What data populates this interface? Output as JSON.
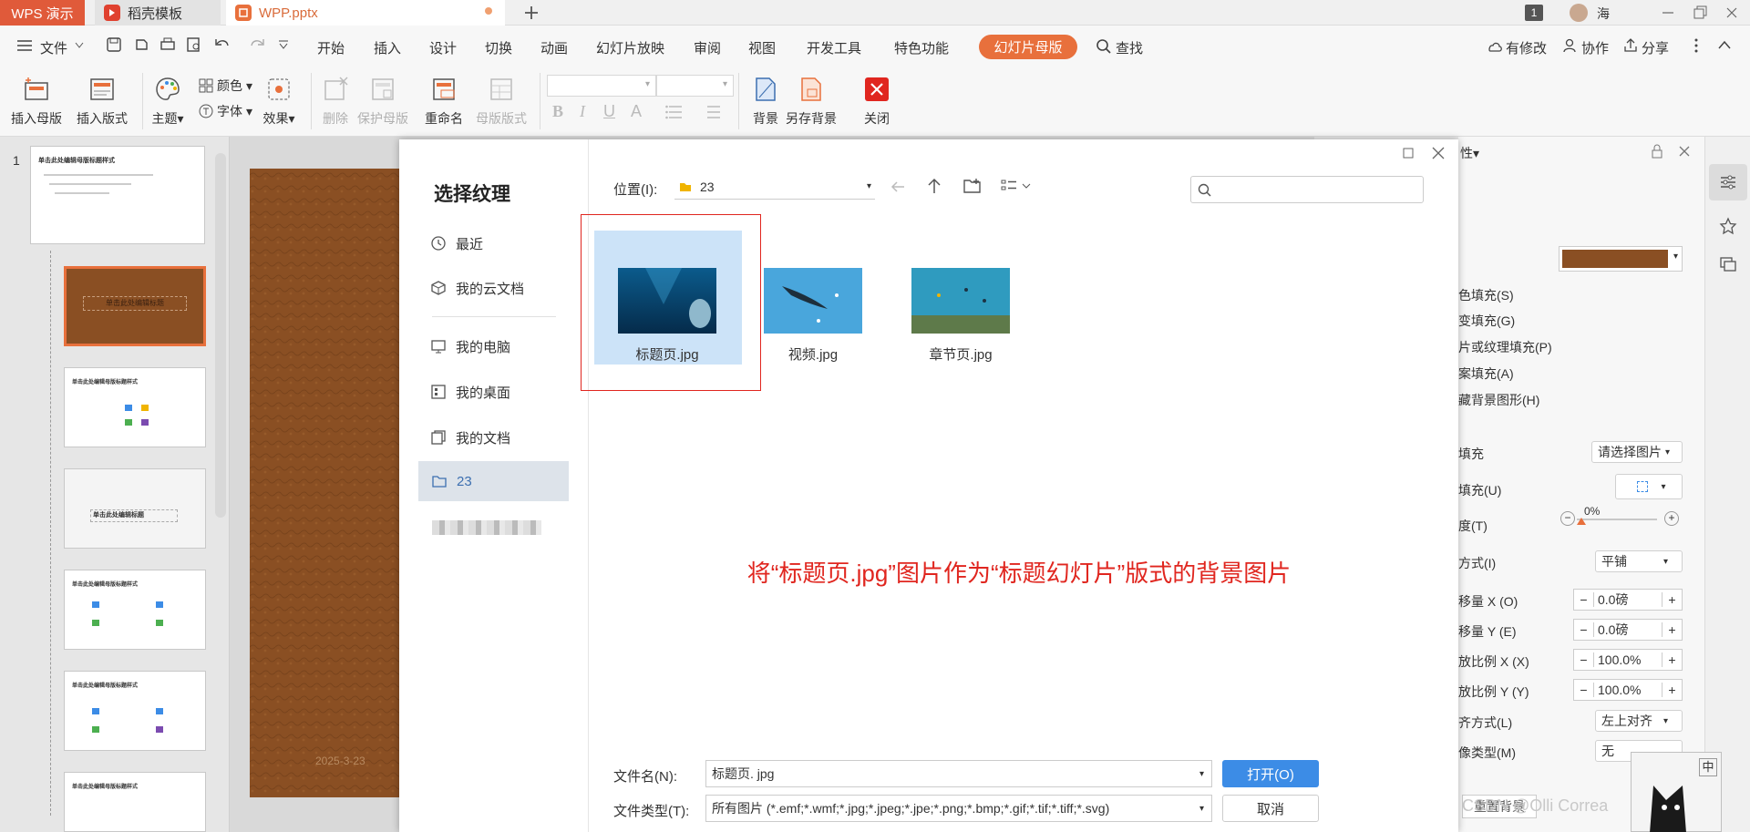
{
  "tabs": {
    "app": "WPS 演示",
    "template": "稻壳模板",
    "file": "WPP.pptx"
  },
  "titlebar": {
    "page_badge": "1",
    "user": "海"
  },
  "menu": {
    "file": "文件",
    "items": [
      "开始",
      "插入",
      "设计",
      "切换",
      "动画",
      "幻灯片放映",
      "审阅",
      "视图",
      "开发工具",
      "特色功能"
    ],
    "active": "幻灯片母版",
    "search": "查找",
    "right": [
      "有修改",
      "协作",
      "分享"
    ]
  },
  "toolbar": {
    "insert_master": "插入母版",
    "insert_layout": "插入版式",
    "theme": "主题",
    "color": "颜色",
    "font": "字体",
    "effect": "效果",
    "delete": "删除",
    "protect_master": "保护母版",
    "rename": "重命名",
    "master_layout": "母版版式",
    "background": "背景",
    "save_background": "另存背景",
    "close": "关闭"
  },
  "thumbnails": {
    "number": "1",
    "master_title": "单击此处编辑母版标题样式",
    "layout_title": "单击此处编辑标题",
    "slide_title": "单击此处编辑标题",
    "date": "2025-3-23"
  },
  "dialog": {
    "title": "选择纹理",
    "side": {
      "recent": "最近",
      "cloud": "我的云文档",
      "pc": "我的电脑",
      "desktop": "我的桌面",
      "docs": "我的文档",
      "folder": "23"
    },
    "location_label": "位置(I):",
    "location_value": "23",
    "search_placeholder": "",
    "files": [
      {
        "name": "标题页.jpg"
      },
      {
        "name": "视频.jpg"
      },
      {
        "name": "章节页.jpg"
      }
    ],
    "annotation": "将“标题页.jpg”图片作为“标题幻灯片”版式的背景图片",
    "filename_label": "文件名(N):",
    "filename_value": "标题页. jpg",
    "filetype_label": "文件类型(T):",
    "filetype_value": "所有图片 (*.emf;*.wmf;*.jpg;*.jpeg;*.jpe;*.png;*.bmp;*.gif;*.tif;*.tiff;*.svg)",
    "open": "打开(O)",
    "cancel": "取消"
  },
  "panel": {
    "header": "性",
    "options": [
      "色填充(S)",
      "变填充(G)",
      "片或纹理填充(P)",
      "案填充(A)",
      "藏背景图形(H)"
    ],
    "fill_label": "填充",
    "fill_value": "请选择图片",
    "tex_label": "填充(U)",
    "transp_label": "度(T)",
    "transp_value": "0%",
    "mode_label": "方式(I)",
    "mode_value": "平铺",
    "offx_label": "移量 X (O)",
    "offx_value": "0.0磅",
    "offy_label": "移量 Y (E)",
    "offy_value": "0.0磅",
    "scx_label": "放比例 X (X)",
    "scx_value": "100.0%",
    "scy_label": "放比例 Y (Y)",
    "scy_value": "100.0%",
    "align_label": "齐方式(L)",
    "align_value": "左上对齐",
    "mirror_label": "像类型(M)",
    "mirror_value": "无",
    "bottom_btn": "重置背景",
    "ime": "中",
    "watermark": "CSDN @Olli Correa"
  },
  "colors": {
    "accent": "#e8703c",
    "primary": "#3c8ce6",
    "annotation": "#e0261f",
    "leather": "#8a4f23"
  }
}
